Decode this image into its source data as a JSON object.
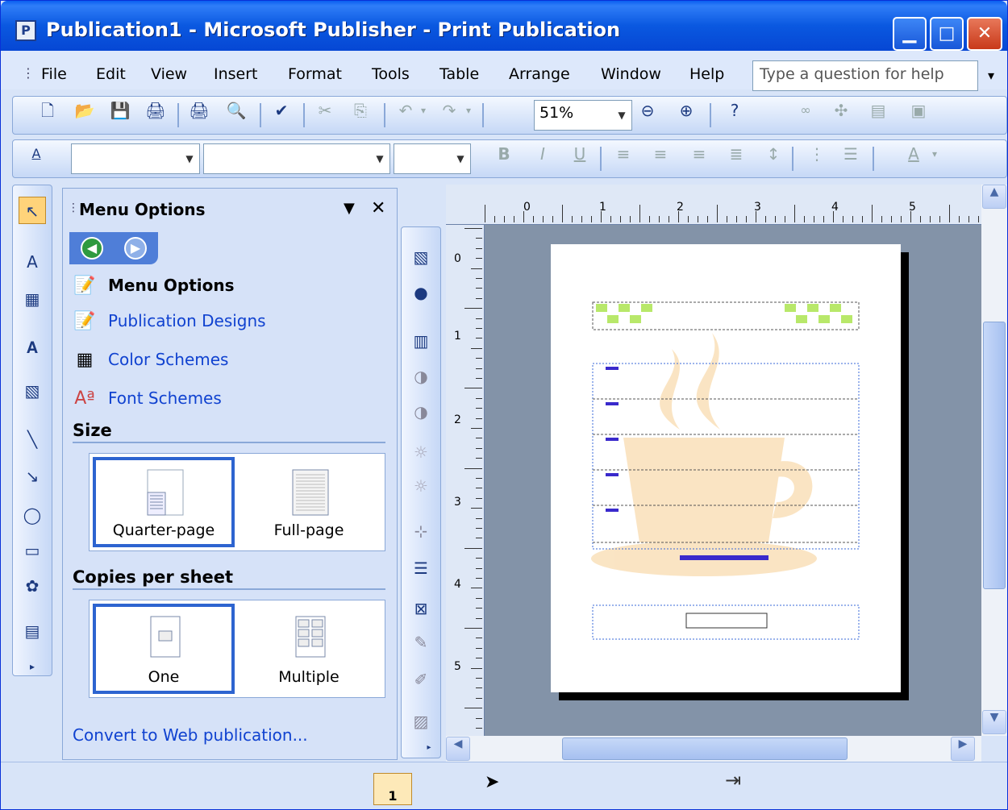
{
  "window": {
    "title": "Publication1 - Microsoft Publisher - Print Publication"
  },
  "menu": [
    "File",
    "Edit",
    "View",
    "Insert",
    "Format",
    "Tools",
    "Table",
    "Arrange",
    "Window",
    "Help"
  ],
  "help_placeholder": "Type a question for help",
  "toolbar": {
    "zoom": "51%"
  },
  "taskpane": {
    "title": "Menu Options",
    "links": [
      "Menu Options",
      "Publication Designs",
      "Color Schemes",
      "Font Schemes"
    ],
    "size_heading": "Size",
    "size_options": [
      "Quarter-page",
      "Full-page"
    ],
    "size_selected": "Quarter-page",
    "copies_heading": "Copies per sheet",
    "copies_options": [
      "One",
      "Multiple"
    ],
    "copies_selected": "One",
    "web_link": "Convert to Web publication..."
  },
  "ruler": {
    "top_labels": [
      "0",
      "1",
      "2",
      "3",
      "4",
      "5"
    ],
    "left_labels": [
      "0",
      "1",
      "2",
      "3",
      "4",
      "5"
    ]
  },
  "status": {
    "page": "1"
  },
  "colors": {
    "title_bar": "#0a58e0",
    "accent_blue": "#2d64d0",
    "canvas_gray": "#8393a8",
    "menu_text_purple": "#3a2acc"
  }
}
